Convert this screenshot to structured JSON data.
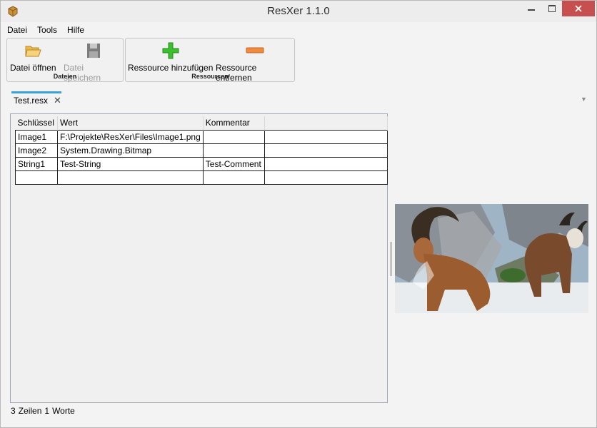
{
  "window": {
    "title": "ResXer 1.1.0"
  },
  "menu": [
    "Datei",
    "Tools",
    "Hilfe"
  ],
  "ribbon": {
    "groups": [
      {
        "label": "Dateien",
        "buttons": [
          {
            "label": "Datei öffnen",
            "icon": "folder-open-icon",
            "enabled": true
          },
          {
            "label": "Datei speichern",
            "icon": "floppy-disk-icon",
            "enabled": false
          }
        ]
      },
      {
        "label": "Ressourcen",
        "buttons": [
          {
            "label": "Ressource hinzufügen",
            "icon": "plus-icon",
            "enabled": true
          },
          {
            "label": "Ressource entfernen",
            "icon": "minus-icon",
            "enabled": true
          }
        ]
      }
    ]
  },
  "tab": {
    "label": "Test.resx",
    "close": "✕"
  },
  "grid": {
    "columns": [
      "Schlüssel",
      "Wert",
      "Kommentar"
    ],
    "rows": [
      [
        "Image1",
        "F:\\Projekte\\ResXer\\Files\\Image1.png",
        ""
      ],
      [
        "Image2",
        "System.Drawing.Bitmap",
        ""
      ],
      [
        "String1",
        "Test-String",
        "Test-Comment"
      ]
    ]
  },
  "status": {
    "lines": "3",
    "lines_label": "Zeilen",
    "words": "1",
    "words_label": "Worte"
  },
  "colors": {
    "close_button": "#c74f4f",
    "tab_accent": "#3aa2d8",
    "add_green": "#3cbf2f",
    "remove_orange": "#f08a3c"
  }
}
